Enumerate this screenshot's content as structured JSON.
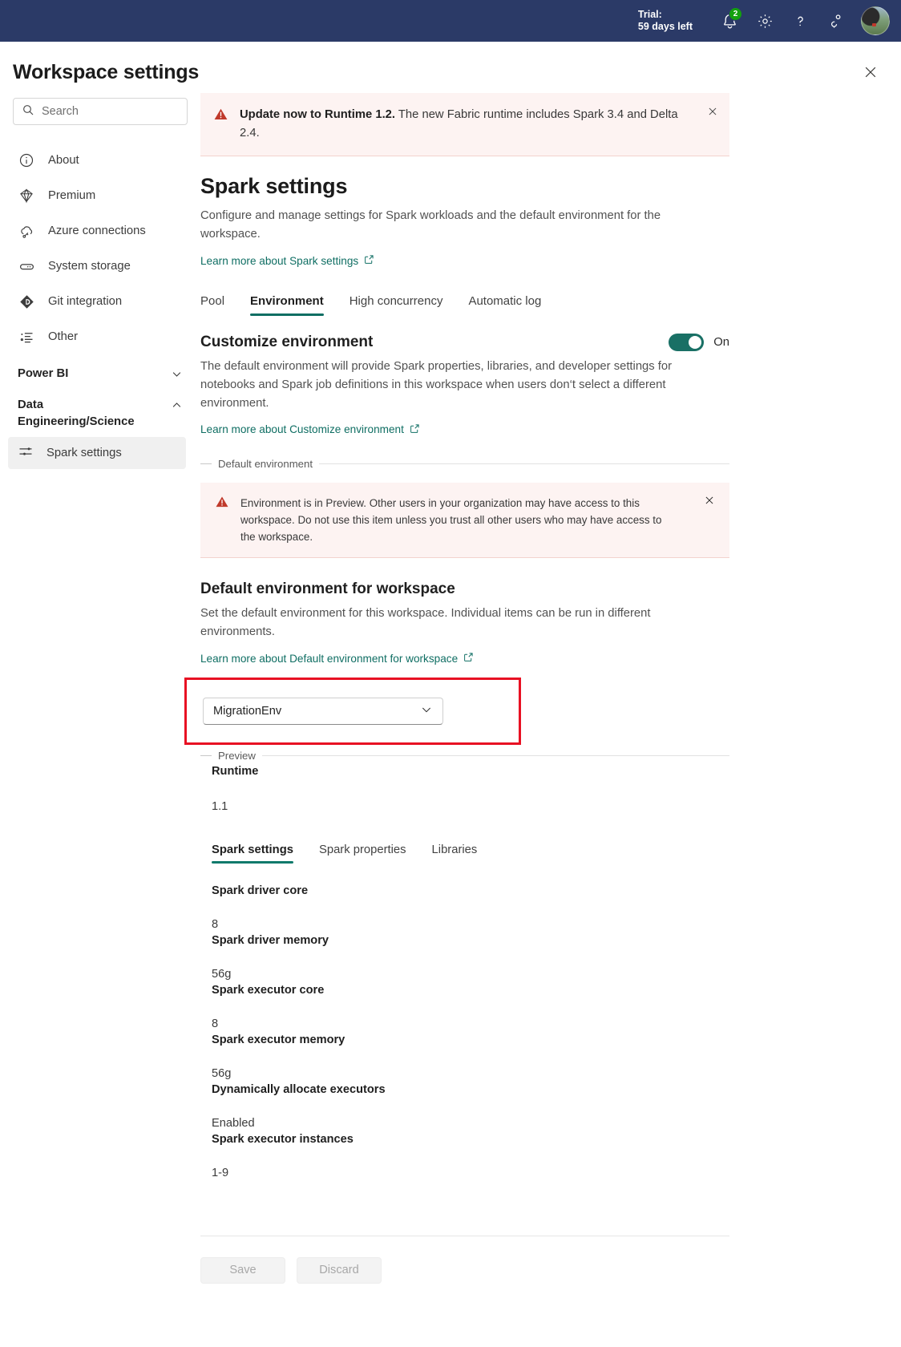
{
  "topbar": {
    "trial_line1": "Trial:",
    "trial_line2": "59 days left",
    "notification_badge": "2",
    "icons": [
      "bell-icon",
      "gear-icon",
      "help-icon",
      "feedback-icon",
      "avatar"
    ]
  },
  "header": {
    "title": "Workspace settings",
    "close_label": "Close"
  },
  "sidebar": {
    "search_placeholder": "Search",
    "search_value": "",
    "items": [
      {
        "label": "About",
        "icon": "info-icon"
      },
      {
        "label": "Premium",
        "icon": "diamond-icon"
      },
      {
        "label": "Azure connections",
        "icon": "cloud-connection-icon"
      },
      {
        "label": "System storage",
        "icon": "storage-icon"
      },
      {
        "label": "Git integration",
        "icon": "git-icon"
      },
      {
        "label": "Other",
        "icon": "list-icon"
      }
    ],
    "groups": [
      {
        "label": "Power BI",
        "state": "collapsed"
      },
      {
        "label": "Data Engineering/Science",
        "state": "expanded"
      }
    ],
    "subitems": [
      {
        "label": "Spark settings",
        "icon": "sliders-icon",
        "selected": true
      }
    ]
  },
  "main": {
    "runtime_alert": {
      "strong": "Update now to Runtime 1.2.",
      "rest": " The new Fabric runtime includes Spark 3.4 and Delta 2.4."
    },
    "section_title": "Spark settings",
    "section_desc": "Configure and manage settings for Spark workloads and the default environment for the workspace.",
    "section_learn": "Learn more about Spark settings",
    "tabs": [
      {
        "label": "Pool",
        "active": false
      },
      {
        "label": "Environment",
        "active": true
      },
      {
        "label": "High concurrency",
        "active": false
      },
      {
        "label": "Automatic log",
        "active": false
      }
    ],
    "customize": {
      "title": "Customize environment",
      "toggle_state": "On",
      "desc": "The default environment will provide Spark properties, libraries, and developer settings for notebooks and Spark job definitions in this workspace when users don‘t select a different environment.",
      "learn": "Learn more about Customize environment"
    },
    "default_env_divider": "Default environment",
    "preview_alert": "Environment is in Preview. Other users in your organization may have access to this workspace. Do not use this item unless you trust all other users who may have access to the workspace.",
    "default_env": {
      "title": "Default environment for workspace",
      "desc": "Set the default environment for this workspace. Individual items can be run in different environments.",
      "learn": "Learn more about Default environment for workspace",
      "select_value": "MigrationEnv",
      "highlight_color": "#e81123"
    },
    "preview_divider": "Preview",
    "runtime": {
      "label": "Runtime",
      "value": "1.1"
    },
    "env_tabs": [
      {
        "label": "Spark settings",
        "active": true
      },
      {
        "label": "Spark properties",
        "active": false
      },
      {
        "label": "Libraries",
        "active": false
      }
    ],
    "properties": [
      {
        "name": "Spark driver core",
        "value": "8"
      },
      {
        "name": "Spark driver memory",
        "value": "56g"
      },
      {
        "name": "Spark executor core",
        "value": "8"
      },
      {
        "name": "Spark executor memory",
        "value": "56g"
      },
      {
        "name": "Dynamically allocate executors",
        "value": "Enabled"
      },
      {
        "name": "Spark executor instances",
        "value": "1-9"
      }
    ],
    "footer": {
      "save_label": "Save",
      "discard_label": "Discard"
    }
  },
  "colors": {
    "topbar_bg": "#2b3a67",
    "accent_teal": "#0f6e63",
    "toggle_on": "#197065",
    "alert_bg": "#fdf3f2",
    "warn_red": "#c0392b",
    "highlight": "#e81123",
    "badge_green": "#13a10e"
  }
}
